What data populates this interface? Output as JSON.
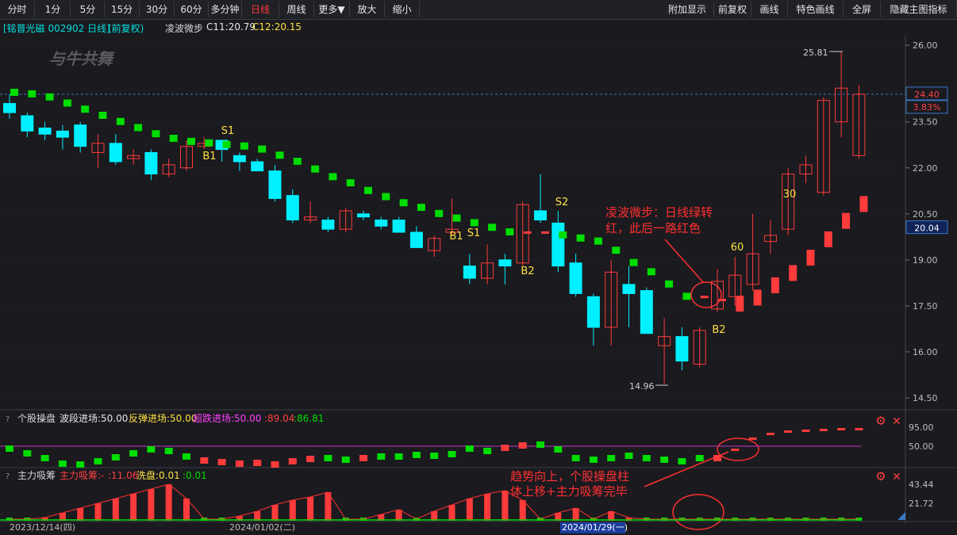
{
  "toolbar": {
    "left": [
      "分时",
      "1分",
      "5分",
      "15分",
      "30分",
      "60分",
      "多分钟",
      "日线",
      "周线",
      "更多▼",
      "放大",
      "缩小"
    ],
    "active": "日线",
    "right": [
      "附加显示",
      "前复权",
      "画线",
      "特色画线",
      "全屏",
      "隐藏主图指标"
    ]
  },
  "header": {
    "stock": "[铭普光磁 002902 日线]",
    "adjust": "(前复权)",
    "indicator": "凌波微步",
    "c1": "C11:20.79",
    "c2": "C12:20.15"
  },
  "watermark": "与牛共舞",
  "main_axis": {
    "ticks": [
      "26.00",
      "23.50",
      "22.00",
      "20.50",
      "19.00",
      "17.50",
      "16.00",
      "14.50"
    ],
    "tick_values": [
      26.0,
      23.5,
      22.0,
      20.5,
      19.0,
      17.5,
      16.0,
      14.5
    ],
    "price_tag": "24.40",
    "pct_tag": "3.83%",
    "box_tag": "20.04"
  },
  "annotations": {
    "high": "25.81",
    "low": "14.96",
    "note1_line1": "凌波微步：日线绿转",
    "note1_line2": "红，此后一路红色",
    "note2_line1": "趋势向上，个股操盘柱",
    "note2_line2": "体上移+主力吸筹完毕"
  },
  "signals": [
    "B1",
    "S1",
    "B1",
    "S1",
    "B2",
    "S2",
    "B2",
    "60",
    "30"
  ],
  "panel2": {
    "name": "个股操盘",
    "l1": "波段进场:50.00",
    "l2": "反弹进场:50.00",
    "l3": "超跌进场:50.00",
    "l4": ":89.04",
    "l5": ":86.81",
    "ticks": [
      "95.00",
      "50.00"
    ]
  },
  "panel3": {
    "name": "主力吸筹",
    "l1": "主力吸筹:-",
    "l2": ":11.06",
    "l3": "洗盘:0.01",
    "l4": ":0.01",
    "ticks": [
      "43.44",
      "21.72"
    ]
  },
  "dates": [
    "2023/12/14(四)",
    "2024/01/02(二)",
    "2024/01/29(一)"
  ],
  "colors": {
    "up": "#ff3b3b",
    "down": "#00f0ff",
    "green": "#00dd00",
    "magenta": "#cc33cc",
    "yellow": "#ffe040"
  },
  "chart_data": {
    "type": "candlestick",
    "candles": [
      {
        "o": 24.1,
        "c": 23.8,
        "h": 24.4,
        "l": 23.6
      },
      {
        "o": 23.7,
        "c": 23.2,
        "h": 23.8,
        "l": 23.0
      },
      {
        "o": 23.3,
        "c": 23.1,
        "h": 23.5,
        "l": 22.9
      },
      {
        "o": 23.2,
        "c": 23.0,
        "h": 23.4,
        "l": 22.6
      },
      {
        "o": 23.4,
        "c": 22.7,
        "h": 23.5,
        "l": 22.5
      },
      {
        "o": 22.5,
        "c": 22.8,
        "h": 23.1,
        "l": 22.0
      },
      {
        "o": 22.8,
        "c": 22.2,
        "h": 23.1,
        "l": 22.1
      },
      {
        "o": 22.3,
        "c": 22.4,
        "h": 22.6,
        "l": 22.1
      },
      {
        "o": 22.5,
        "c": 21.8,
        "h": 22.6,
        "l": 21.6
      },
      {
        "o": 21.8,
        "c": 22.1,
        "h": 22.3,
        "l": 21.7
      },
      {
        "o": 22.0,
        "c": 22.7,
        "h": 22.9,
        "l": 21.9
      },
      {
        "o": 22.7,
        "c": 22.8,
        "h": 23.0,
        "l": 22.6
      },
      {
        "o": 22.9,
        "c": 22.6,
        "h": 22.9,
        "l": 22.2
      },
      {
        "o": 22.4,
        "c": 22.2,
        "h": 22.5,
        "l": 21.9
      },
      {
        "o": 22.2,
        "c": 21.9,
        "h": 22.3,
        "l": 21.9
      },
      {
        "o": 21.9,
        "c": 21.0,
        "h": 22.1,
        "l": 20.9
      },
      {
        "o": 21.1,
        "c": 20.3,
        "h": 21.3,
        "l": 20.2
      },
      {
        "o": 20.3,
        "c": 20.4,
        "h": 20.9,
        "l": 20.2
      },
      {
        "o": 20.3,
        "c": 20.0,
        "h": 20.4,
        "l": 19.9
      },
      {
        "o": 20.0,
        "c": 20.6,
        "h": 20.7,
        "l": 19.9
      },
      {
        "o": 20.5,
        "c": 20.4,
        "h": 20.6,
        "l": 20.3
      },
      {
        "o": 20.3,
        "c": 20.1,
        "h": 20.4,
        "l": 20.0
      },
      {
        "o": 20.3,
        "c": 19.9,
        "h": 20.4,
        "l": 19.9
      },
      {
        "o": 19.9,
        "c": 19.4,
        "h": 20.1,
        "l": 19.4
      },
      {
        "o": 19.3,
        "c": 19.7,
        "h": 19.8,
        "l": 19.1
      },
      {
        "o": 19.9,
        "c": 20.0,
        "h": 21.0,
        "l": 19.8
      },
      {
        "o": 18.8,
        "c": 18.4,
        "h": 19.2,
        "l": 18.2
      },
      {
        "o": 18.4,
        "c": 18.9,
        "h": 19.5,
        "l": 18.2
      },
      {
        "o": 19.0,
        "c": 18.8,
        "h": 19.2,
        "l": 18.2
      },
      {
        "o": 18.9,
        "c": 20.8,
        "h": 20.9,
        "l": 18.8
      },
      {
        "o": 20.6,
        "c": 20.3,
        "h": 21.8,
        "l": 20.2
      },
      {
        "o": 20.2,
        "c": 18.8,
        "h": 20.6,
        "l": 18.6
      },
      {
        "o": 18.9,
        "c": 17.9,
        "h": 19.2,
        "l": 17.8
      },
      {
        "o": 17.8,
        "c": 16.8,
        "h": 17.9,
        "l": 16.2
      },
      {
        "o": 16.8,
        "c": 18.6,
        "h": 19.0,
        "l": 16.2
      },
      {
        "o": 18.2,
        "c": 17.9,
        "h": 18.8,
        "l": 16.8
      },
      {
        "o": 18.0,
        "c": 16.6,
        "h": 18.1,
        "l": 16.6
      },
      {
        "o": 16.2,
        "c": 16.5,
        "h": 17.1,
        "l": 14.96
      },
      {
        "o": 16.5,
        "c": 15.7,
        "h": 16.8,
        "l": 15.4
      },
      {
        "o": 15.6,
        "c": 16.7,
        "h": 16.8,
        "l": 15.5
      },
      {
        "o": 17.4,
        "c": 18.3,
        "h": 18.7,
        "l": 17.3
      },
      {
        "o": 17.8,
        "c": 18.5,
        "h": 19.1,
        "l": 17.5
      },
      {
        "o": 18.2,
        "c": 19.2,
        "h": 20.5,
        "l": 18.0
      },
      {
        "o": 19.6,
        "c": 19.8,
        "h": 20.3,
        "l": 19.2
      },
      {
        "o": 20.0,
        "c": 21.8,
        "h": 22.0,
        "l": 19.8
      },
      {
        "o": 21.8,
        "c": 22.1,
        "h": 22.4,
        "l": 21.5
      },
      {
        "o": 21.2,
        "c": 24.2,
        "h": 24.3,
        "l": 21.1
      },
      {
        "o": 23.5,
        "c": 24.6,
        "h": 25.81,
        "l": 23.0
      },
      {
        "o": 22.4,
        "c": 24.4,
        "h": 24.7,
        "l": 22.3
      }
    ],
    "lbwb": [
      {
        "v": 24.45,
        "g": true
      },
      {
        "v": 24.4,
        "g": true
      },
      {
        "v": 24.3,
        "g": true
      },
      {
        "v": 24.1,
        "g": true
      },
      {
        "v": 23.9,
        "g": true
      },
      {
        "v": 23.7,
        "g": true
      },
      {
        "v": 23.5,
        "g": true
      },
      {
        "v": 23.3,
        "g": true
      },
      {
        "v": 23.1,
        "g": true
      },
      {
        "v": 22.95,
        "g": true
      },
      {
        "v": 22.85,
        "g": true
      },
      {
        "v": 22.8,
        "g": true
      },
      {
        "v": 22.75,
        "g": true
      },
      {
        "v": 22.7,
        "g": true
      },
      {
        "v": 22.6,
        "g": true
      },
      {
        "v": 22.4,
        "g": true
      },
      {
        "v": 22.2,
        "g": true
      },
      {
        "v": 21.95,
        "g": true
      },
      {
        "v": 21.7,
        "g": true
      },
      {
        "v": 21.5,
        "g": true
      },
      {
        "v": 21.25,
        "g": true
      },
      {
        "v": 21.05,
        "g": true
      },
      {
        "v": 20.85,
        "g": true
      },
      {
        "v": 20.7,
        "g": true
      },
      {
        "v": 20.5,
        "g": true
      },
      {
        "v": 20.35,
        "g": true
      },
      {
        "v": 20.2,
        "g": true
      },
      {
        "v": 20.05,
        "g": true
      },
      {
        "v": 19.9,
        "g": true
      },
      {
        "v": 19.8,
        "g": false
      },
      {
        "v": 19.8,
        "g": false
      },
      {
        "v": 19.8,
        "g": true
      },
      {
        "v": 19.7,
        "g": true
      },
      {
        "v": 19.6,
        "g": true
      },
      {
        "v": 19.3,
        "g": true
      },
      {
        "v": 18.9,
        "g": true
      },
      {
        "v": 18.6,
        "g": true
      },
      {
        "v": 18.2,
        "g": true
      },
      {
        "v": 17.8,
        "g": true
      },
      {
        "v": 17.7,
        "g": false
      },
      {
        "v": 17.6,
        "g": false
      },
      {
        "v": 17.7,
        "g": false
      },
      {
        "v": 17.9,
        "g": false
      },
      {
        "v": 18.3,
        "g": false
      },
      {
        "v": 18.7,
        "g": false
      },
      {
        "v": 19.2,
        "g": false
      },
      {
        "v": 19.8,
        "g": false
      },
      {
        "v": 20.4,
        "g": false
      },
      {
        "v": 20.95,
        "g": false
      }
    ],
    "ylim": [
      14.5,
      26.6
    ]
  }
}
